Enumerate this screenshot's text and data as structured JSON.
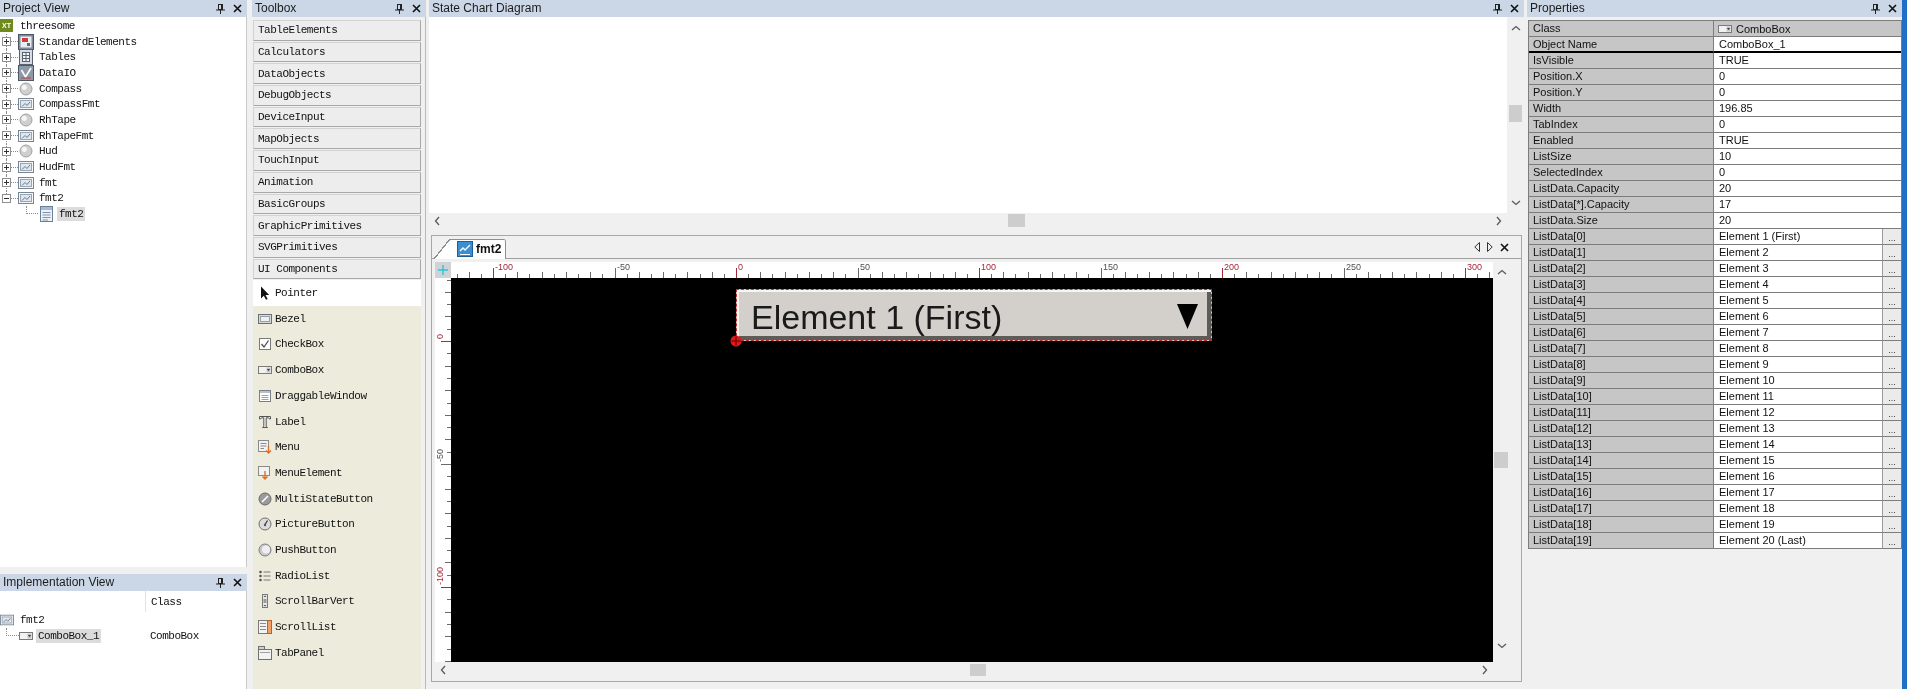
{
  "project_view": {
    "title": "Project View",
    "tree": [
      {
        "label": "threesome",
        "kind": "project",
        "logo": "XT",
        "selected": false,
        "children": [
          {
            "label": "StandardElements",
            "kind": "library",
            "expanded": false,
            "selected": false
          },
          {
            "label": "Tables",
            "kind": "table",
            "expanded": false,
            "selected": false
          },
          {
            "label": "DataIO",
            "kind": "data",
            "expanded": false,
            "selected": false
          },
          {
            "label": "Compass",
            "kind": "object",
            "expanded": false,
            "selected": false
          },
          {
            "label": "CompassFmt",
            "kind": "format",
            "expanded": false,
            "selected": false
          },
          {
            "label": "RhTape",
            "kind": "object",
            "expanded": false,
            "selected": false
          },
          {
            "label": "RhTapeFmt",
            "kind": "format",
            "expanded": false,
            "selected": false
          },
          {
            "label": "Hud",
            "kind": "object",
            "expanded": false,
            "selected": false
          },
          {
            "label": "HudFmt",
            "kind": "format",
            "expanded": false,
            "selected": false
          },
          {
            "label": "fmt",
            "kind": "format",
            "expanded": false,
            "selected": false
          },
          {
            "label": "fmt2",
            "kind": "format",
            "expanded": true,
            "selected": false,
            "children": [
              {
                "label": "fmt2",
                "kind": "page",
                "selected": true
              }
            ]
          }
        ]
      }
    ]
  },
  "implementation_view": {
    "title": "Implementation View",
    "column_header": "Class",
    "tree": [
      {
        "label": "fmt2",
        "kind": "format",
        "selected": false,
        "children": [
          {
            "label": "ComboBox_1",
            "kind": "combobox",
            "class": "ComboBox",
            "selected": true
          }
        ]
      }
    ]
  },
  "toolbox": {
    "title": "Toolbox",
    "categories": [
      "TableElements",
      "Calculators",
      "DataObjects",
      "DebugObjects",
      "DeviceInput",
      "MapObjects",
      "TouchInput",
      "Animation",
      "BasicGroups",
      "GraphicPrimitives",
      "SVGPrimitives",
      "UI Components"
    ],
    "items": [
      {
        "label": "Pointer",
        "selected": true
      },
      {
        "label": "Bezel",
        "selected": false
      },
      {
        "label": "CheckBox",
        "selected": false
      },
      {
        "label": "ComboBox",
        "selected": false
      },
      {
        "label": "DraggableWindow",
        "selected": false
      },
      {
        "label": "Label",
        "selected": false
      },
      {
        "label": "Menu",
        "selected": false
      },
      {
        "label": "MenuElement",
        "selected": false
      },
      {
        "label": "MultiStateButton",
        "selected": false
      },
      {
        "label": "PictureButton",
        "selected": false
      },
      {
        "label": "PushButton",
        "selected": false
      },
      {
        "label": "RadioList",
        "selected": false
      },
      {
        "label": "ScrollBarVert",
        "selected": false
      },
      {
        "label": "ScrollList",
        "selected": false
      },
      {
        "label": "TabPanel",
        "selected": false
      }
    ]
  },
  "state_chart": {
    "title": "State Chart Diagram"
  },
  "design_view": {
    "tabs": [
      {
        "label": "fmt2",
        "selected": true
      }
    ],
    "horizontal_ruler": [
      "-100",
      "-50",
      "0",
      "50",
      "100",
      "150",
      "200",
      "250",
      "300"
    ],
    "vertical_ruler": [
      "0",
      "-50",
      "-100"
    ],
    "combo_box": {
      "value": "Element 1 (First)"
    }
  },
  "properties": {
    "title": "Properties",
    "rows": [
      {
        "name": "Class",
        "value": "ComboBox",
        "kind": "class",
        "selected": false
      },
      {
        "name": "Object Name",
        "value": "ComboBox_1",
        "kind": "field",
        "selected": true
      },
      {
        "name": "IsVisible",
        "value": "TRUE",
        "kind": "field",
        "selected": false
      },
      {
        "name": "Position.X",
        "value": "0",
        "kind": "field",
        "selected": false
      },
      {
        "name": "Position.Y",
        "value": "0",
        "kind": "field",
        "selected": false
      },
      {
        "name": "Width",
        "value": "196.85",
        "kind": "field",
        "selected": false
      },
      {
        "name": "TabIndex",
        "value": "0",
        "kind": "field",
        "selected": false
      },
      {
        "name": "Enabled",
        "value": "TRUE",
        "kind": "field",
        "selected": false
      },
      {
        "name": "ListSize",
        "value": "10",
        "kind": "field",
        "selected": false
      },
      {
        "name": "SelectedIndex",
        "value": "0",
        "kind": "field",
        "selected": false
      },
      {
        "name": "ListData.Capacity",
        "value": "20",
        "kind": "field",
        "selected": false
      },
      {
        "name": "ListData[*].Capacity",
        "value": "17",
        "kind": "field",
        "selected": false
      },
      {
        "name": "ListData.Size",
        "value": "20",
        "kind": "field",
        "selected": false
      },
      {
        "name": "ListData[0]",
        "value": "Element 1 (First)",
        "kind": "list",
        "button": "...",
        "selected": false
      },
      {
        "name": "ListData[1]",
        "value": "Element 2",
        "kind": "list",
        "button": "...",
        "selected": false
      },
      {
        "name": "ListData[2]",
        "value": "Element 3",
        "kind": "list",
        "button": "...",
        "selected": false
      },
      {
        "name": "ListData[3]",
        "value": "Element 4",
        "kind": "list",
        "button": "...",
        "selected": false
      },
      {
        "name": "ListData[4]",
        "value": "Element 5",
        "kind": "list",
        "button": "...",
        "selected": false
      },
      {
        "name": "ListData[5]",
        "value": "Element 6",
        "kind": "list",
        "button": "...",
        "selected": false
      },
      {
        "name": "ListData[6]",
        "value": "Element 7",
        "kind": "list",
        "button": "...",
        "selected": false
      },
      {
        "name": "ListData[7]",
        "value": "Element 8",
        "kind": "list",
        "button": "...",
        "selected": false
      },
      {
        "name": "ListData[8]",
        "value": "Element 9",
        "kind": "list",
        "button": "...",
        "selected": false
      },
      {
        "name": "ListData[9]",
        "value": "Element 10",
        "kind": "list",
        "button": "...",
        "selected": false
      },
      {
        "name": "ListData[10]",
        "value": "Element 11",
        "kind": "list",
        "button": "...",
        "selected": false
      },
      {
        "name": "ListData[11]",
        "value": "Element 12",
        "kind": "list",
        "button": "...",
        "selected": false
      },
      {
        "name": "ListData[12]",
        "value": "Element 13",
        "kind": "list",
        "button": "...",
        "selected": false
      },
      {
        "name": "ListData[13]",
        "value": "Element 14",
        "kind": "list",
        "button": "...",
        "selected": false
      },
      {
        "name": "ListData[14]",
        "value": "Element 15",
        "kind": "list",
        "button": "...",
        "selected": false
      },
      {
        "name": "ListData[15]",
        "value": "Element 16",
        "kind": "list",
        "button": "...",
        "selected": false
      },
      {
        "name": "ListData[16]",
        "value": "Element 17",
        "kind": "list",
        "button": "...",
        "selected": false
      },
      {
        "name": "ListData[17]",
        "value": "Element 18",
        "kind": "list",
        "button": "...",
        "selected": false
      },
      {
        "name": "ListData[18]",
        "value": "Element 19",
        "kind": "list",
        "button": "...",
        "selected": false
      },
      {
        "name": "ListData[19]",
        "value": "Element 20 (Last)",
        "kind": "list",
        "button": "...",
        "selected": false
      }
    ]
  }
}
